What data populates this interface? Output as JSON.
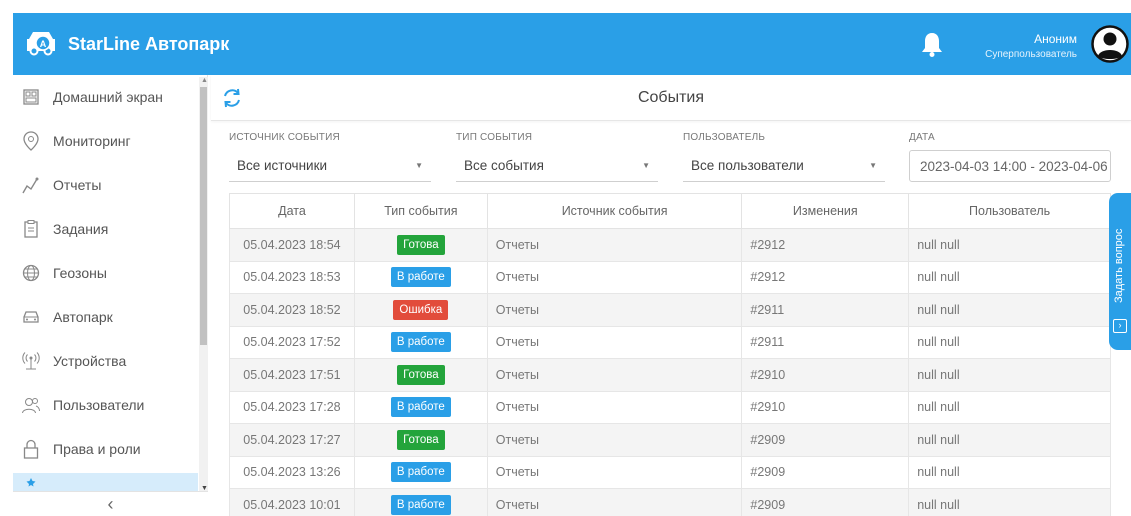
{
  "header": {
    "brand": "StarLine Автопарк",
    "user_name": "Аноним",
    "user_role": "Суперпользователь"
  },
  "sidebar": {
    "items": [
      {
        "label": "Домашний экран",
        "icon": "home-screen-icon"
      },
      {
        "label": "Мониторинг",
        "icon": "location-pin-icon"
      },
      {
        "label": "Отчеты",
        "icon": "chart-line-icon"
      },
      {
        "label": "Задания",
        "icon": "clipboard-icon"
      },
      {
        "label": "Геозоны",
        "icon": "globe-icon"
      },
      {
        "label": "Автопарк",
        "icon": "car-icon"
      },
      {
        "label": "Устройства",
        "icon": "antenna-icon"
      },
      {
        "label": "Пользователи",
        "icon": "users-icon"
      },
      {
        "label": "Права и роли",
        "icon": "lock-icon"
      }
    ],
    "collapse_label": "‹"
  },
  "events": {
    "title": "События",
    "filters": {
      "source": {
        "label": "ИСТОЧНИК СОБЫТИЯ",
        "value": "Все источники"
      },
      "type": {
        "label": "ТИП СОБЫТИЯ",
        "value": "Все события"
      },
      "user": {
        "label": "ПОЛЬЗОВАТЕЛЬ",
        "value": "Все пользователи"
      },
      "date": {
        "label": "ДАТА",
        "value": "2023-04-03 14:00 - 2023-04-06"
      }
    },
    "columns": [
      "Дата",
      "Тип события",
      "Источник события",
      "Изменения",
      "Пользователь"
    ],
    "rows": [
      {
        "date": "05.04.2023 18:54",
        "type": "Готова",
        "status": "ok",
        "source": "Отчеты",
        "change": "#2912",
        "user": "null null"
      },
      {
        "date": "05.04.2023 18:53",
        "type": "В работе",
        "status": "work",
        "source": "Отчеты",
        "change": "#2912",
        "user": "null null"
      },
      {
        "date": "05.04.2023 18:52",
        "type": "Ошибка",
        "status": "err",
        "source": "Отчеты",
        "change": "#2911",
        "user": "null null"
      },
      {
        "date": "05.04.2023 17:52",
        "type": "В работе",
        "status": "work",
        "source": "Отчеты",
        "change": "#2911",
        "user": "null null"
      },
      {
        "date": "05.04.2023 17:51",
        "type": "Готова",
        "status": "ok",
        "source": "Отчеты",
        "change": "#2910",
        "user": "null null"
      },
      {
        "date": "05.04.2023 17:28",
        "type": "В работе",
        "status": "work",
        "source": "Отчеты",
        "change": "#2910",
        "user": "null null"
      },
      {
        "date": "05.04.2023 17:27",
        "type": "Готова",
        "status": "ok",
        "source": "Отчеты",
        "change": "#2909",
        "user": "null null"
      },
      {
        "date": "05.04.2023 13:26",
        "type": "В работе",
        "status": "work",
        "source": "Отчеты",
        "change": "#2909",
        "user": "null null"
      },
      {
        "date": "05.04.2023 10:01",
        "type": "В работе",
        "status": "work",
        "source": "Отчеты",
        "change": "#2909",
        "user": "null null"
      }
    ]
  },
  "ask_button": {
    "label": "Задать вопрос"
  },
  "colors": {
    "primary": "#2a9fe7",
    "status_ok": "#23a43b",
    "status_work": "#2a9fe7",
    "status_err": "#e24c3b"
  }
}
